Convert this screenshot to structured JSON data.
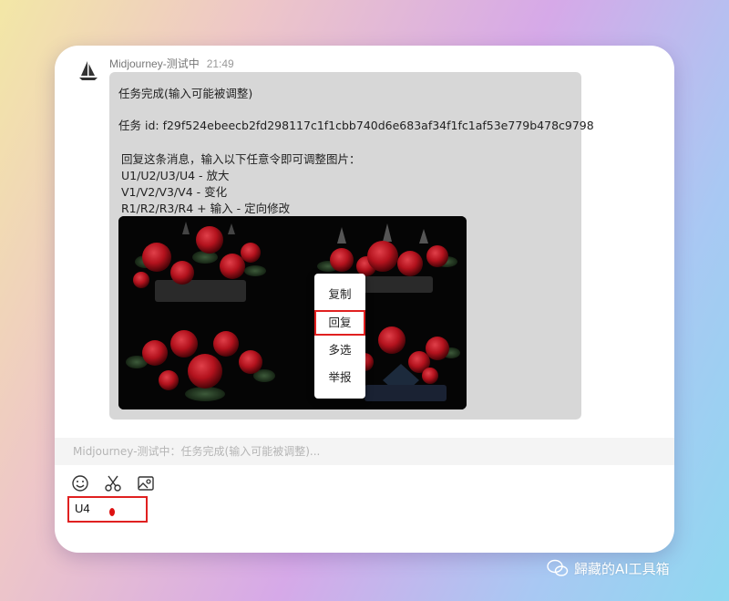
{
  "message": {
    "sender": "Midjourney-测试中",
    "time": "21:49",
    "lines": [
      "任务完成(输入可能被调整)",
      "任务 id: f29f524ebeecb2fd298117c1f1cbb740d6e683af34f1fc1af53e779b478c9798",
      "回复这条消息，输入以下任意令即可调整图片：",
      "U1/U2/U3/U4 - 放大",
      "V1/V2/V3/V4 - 变化",
      "R1/R2/R3/R4 + 输入 - 定向修改"
    ]
  },
  "context_menu": {
    "items": [
      "复制",
      "回复",
      "多选",
      "举报"
    ],
    "highlighted": "回复"
  },
  "quote": "Midjourney-测试中：任务完成(输入可能被调整)...",
  "toolbar": {
    "icons": [
      "emoji-icon",
      "scissors-icon",
      "image-icon"
    ]
  },
  "input": {
    "value": "U4"
  },
  "watermark": {
    "text": "歸藏的AI工具箱"
  },
  "colors": {
    "highlight": "#e02020",
    "bubble": "#d7d7d7",
    "rose": "#b3121d"
  }
}
